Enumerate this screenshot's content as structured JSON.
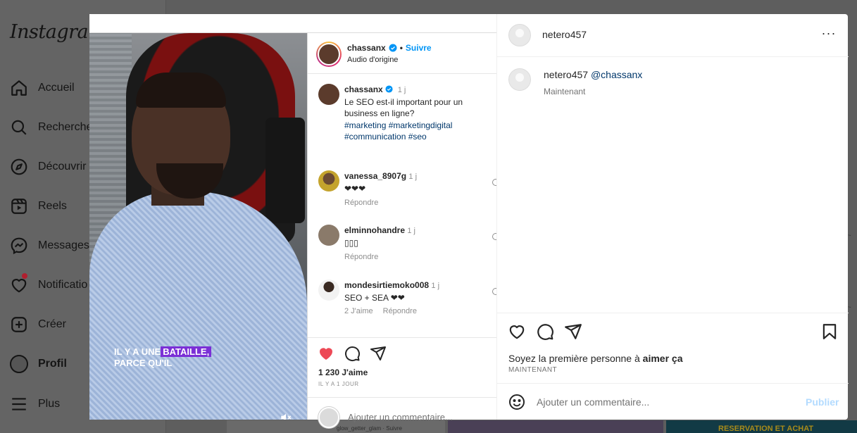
{
  "sidebar": {
    "logo": "Instagram",
    "items": [
      {
        "label": "Accueil",
        "icon": "home-icon"
      },
      {
        "label": "Recherche",
        "icon": "search-icon"
      },
      {
        "label": "Découvrir",
        "icon": "compass-icon"
      },
      {
        "label": "Reels",
        "icon": "reels-icon"
      },
      {
        "label": "Messages",
        "icon": "messenger-icon"
      },
      {
        "label": "Notificatio",
        "icon": "heart-icon"
      },
      {
        "label": "Créer",
        "icon": "plus-square-icon"
      },
      {
        "label": "Profil",
        "icon": "avatar"
      },
      {
        "label": "Plus",
        "icon": "menu-icon"
      }
    ]
  },
  "background": {
    "grid_username": "glow_getter_glam",
    "grid_follow": "Suivre",
    "grid_banner": "RESERVATION ET ACHAT"
  },
  "reel": {
    "author": "chassanx",
    "follow": "Suivre",
    "audio": "Audio d'origine",
    "video_caption_plain": "IL Y A UNE",
    "video_caption_highlight": "BATAILLE,",
    "video_caption_line2": "PARCE QU'IL",
    "caption": {
      "user": "chassanx",
      "time": "1 j",
      "text": "Le SEO est-il important pour un business en ligne?",
      "hashtags": "#marketing #marketingdigital #communication #seo"
    },
    "comments": [
      {
        "user": "vanessa_8907g",
        "time": "1 j",
        "text": "❤❤❤",
        "likes": "",
        "reply": "Répondre"
      },
      {
        "user": "elminnohandre",
        "time": "1 j",
        "text": "▯▯▯",
        "likes": "",
        "reply": "Répondre"
      },
      {
        "user": "mondesirtiemoko008",
        "time": "1 j",
        "text": "SEO + SEA ❤❤",
        "likes": "2 J'aime",
        "reply": "Répondre"
      }
    ],
    "likes": "1 230 J'aime",
    "posted_ago": "IL Y A 1 JOUR",
    "add_comment_placeholder": "Ajouter un commentaire..."
  },
  "post": {
    "username": "netero457",
    "more": "···",
    "caption_user": "netero457",
    "caption_mention": "@chassanx",
    "caption_time": "Maintenant",
    "likes_text_prefix": "Soyez la première personne à ",
    "likes_text_strong": "aimer ça",
    "time": "MAINTENANT",
    "comment_placeholder": "Ajouter un commentaire...",
    "publish_label": "Publier"
  },
  "colors": {
    "accent_blue": "#0095f6",
    "link_dark": "#00376b",
    "liked_red": "#ed4956",
    "publish_disabled": "#b3dbff"
  }
}
